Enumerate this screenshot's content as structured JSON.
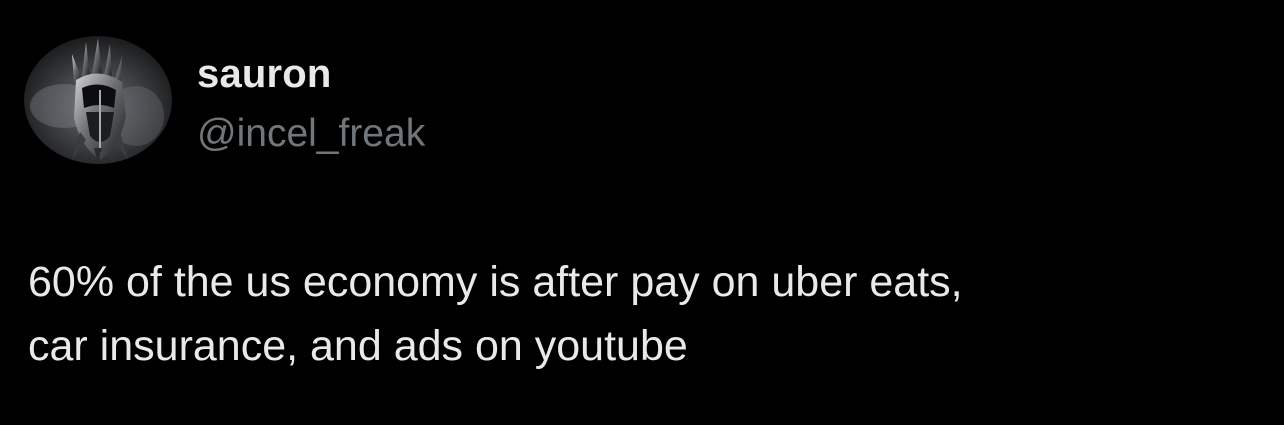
{
  "author": {
    "display_name": "sauron",
    "handle": "@incel_freak",
    "avatar_icon": "sauron-helmet-avatar"
  },
  "tweet": {
    "lines": [
      "60% of the us economy is after pay on uber eats,",
      "car insurance, and ads on youtube"
    ]
  },
  "colors": {
    "background": "#000000",
    "primary_text": "#e7e9ea",
    "secondary_text": "#71767b"
  }
}
